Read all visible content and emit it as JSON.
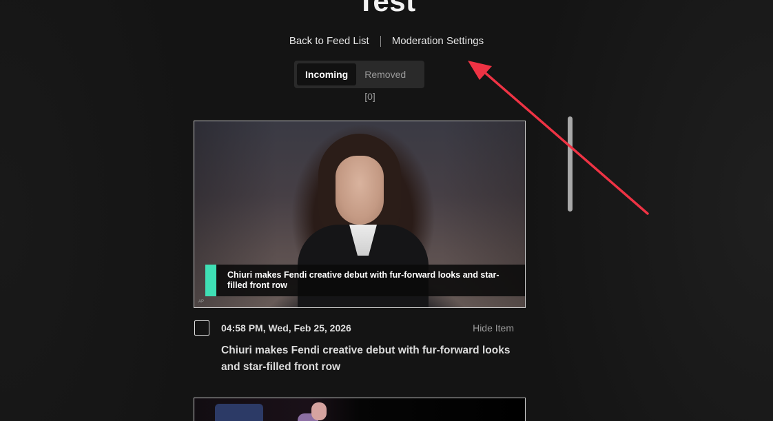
{
  "page": {
    "title": "Test"
  },
  "nav": {
    "back_label": "Back to Feed List",
    "settings_label": "Moderation Settings"
  },
  "tabs": {
    "incoming_label": "Incoming",
    "removed_label": "Removed [0]"
  },
  "items": [
    {
      "image_caption": "Chiuri makes Fendi creative debut with fur-forward looks and star-filled front row",
      "image_credit": "AP",
      "timestamp": "04:58 PM, Wed, Feb 25, 2026",
      "hide_label": "Hide Item",
      "title": "Chiuri makes Fendi creative debut with fur-forward looks and star-filled front row"
    }
  ],
  "colors": {
    "background": "#141414",
    "caption_accent": "#3fe0b5",
    "annotation_arrow": "#ee3344"
  },
  "icons": {
    "checkbox": "checkbox-icon",
    "annotation": "arrow-annotation"
  }
}
